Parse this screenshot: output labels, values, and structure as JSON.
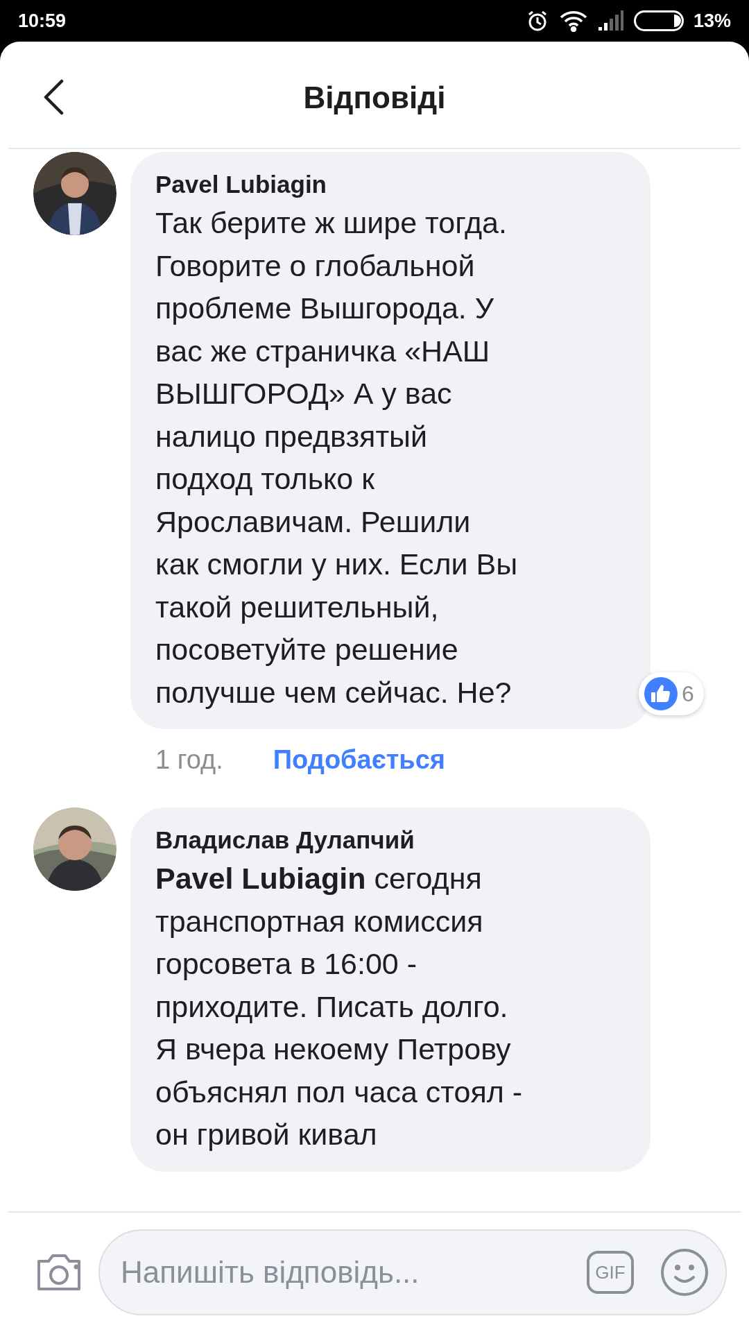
{
  "status_bar": {
    "time": "10:59",
    "battery": "13%"
  },
  "header": {
    "title": "Відповіді"
  },
  "comments": [
    {
      "author": "Pavel Lubiagin",
      "text": "Так берите ж шире тогда.\nГоворите о глобальной\nпроблеме Вышгорода. У\nвас же страничка «НАШ\nВЫШГОРОД» А у вас\nналицо предвзятый\nподход только к\nЯрославичам. Решили\nкак смогли у них. Если Вы\nтакой решительный,\nпосоветуйте решение\nполучше чем сейчас. Не?",
      "reactions": "6",
      "time": "1 год.",
      "like_label": "Подобається"
    },
    {
      "author": "Владислав Дулапчий",
      "text": "**Pavel Lubiagin** сегодня\nтранспортная комиссия\nгорсовета в 16:00 -\nприходите. Писать долго.\nЯ вчера некоему Петрову\nобъяснял пол часа стоял -\nон гривой кивал"
    }
  ],
  "composer": {
    "placeholder": "Напишіть відповідь...",
    "gif_label": "GIF"
  }
}
